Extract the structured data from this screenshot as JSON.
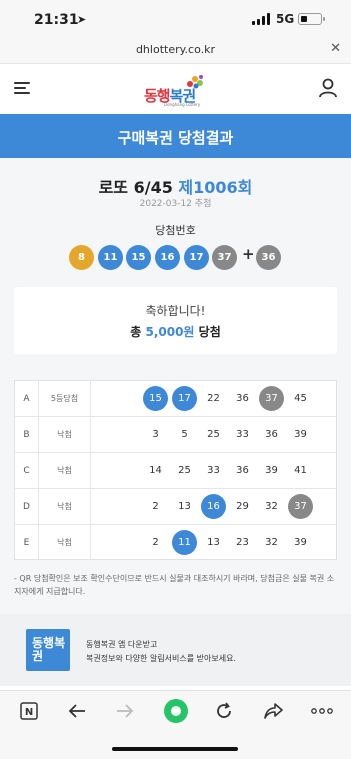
{
  "status_bar": {
    "time": "21:31",
    "network": "5G"
  },
  "url_bar": {
    "url": "dhlottery.co.kr",
    "close_icon": "close-icon"
  },
  "header": {
    "logo_text_red": "동행",
    "logo_text_blue": "복권",
    "logo_subtitle": "Donghang Lottery",
    "menu_icon": "hamburger-icon",
    "user_icon": "user-icon"
  },
  "banner": {
    "title": "구매복권 당첨결과"
  },
  "draw": {
    "game": "로또 6/45",
    "round": "제1006회",
    "date": "2022-03-12 추첨",
    "numbers_label": "당첨번호",
    "numbers": [
      "8",
      "11",
      "15",
      "16",
      "17",
      "37"
    ],
    "bonus": "36",
    "plus": "+"
  },
  "result": {
    "message": "축하합니다!",
    "amount_prefix": "총",
    "amount": "5,000원",
    "amount_suffix": "당첨"
  },
  "ticket": {
    "rows": [
      {
        "line": "A",
        "status": "5등당첨",
        "numbers": [
          "15",
          "17",
          "22",
          "36",
          "37",
          "45"
        ]
      },
      {
        "line": "B",
        "status": "낙첨",
        "numbers": [
          "3",
          "5",
          "25",
          "33",
          "36",
          "39"
        ]
      },
      {
        "line": "C",
        "status": "낙첨",
        "numbers": [
          "14",
          "25",
          "33",
          "36",
          "39",
          "41"
        ]
      },
      {
        "line": "D",
        "status": "낙첨",
        "numbers": [
          "2",
          "13",
          "16",
          "29",
          "32",
          "37"
        ]
      },
      {
        "line": "E",
        "status": "낙첨",
        "numbers": [
          "2",
          "11",
          "13",
          "23",
          "32",
          "39"
        ]
      }
    ]
  },
  "notice": "- QR 당첨확인은 보조 확인수단이므로 반드시 실물과 대조하시기 바라며, 당첨금은 실물 복권 소지자에게 지급합니다.",
  "promo": {
    "logo_text": "동행복권",
    "line1": "동행복권 앱 다운받고",
    "line2": "복권정보와 다양한 알림서비스를 받아보세요."
  },
  "colors": {
    "accent_blue": "#3d88d7",
    "ball_yellow": "#e4a72b",
    "ball_gray": "#888888",
    "logo_red": "#e4343e"
  },
  "toolbar": {
    "icons": [
      "naver-n-icon",
      "back-arrow-icon",
      "forward-arrow-icon",
      "home-circle-icon",
      "reload-icon",
      "share-icon",
      "more-icon"
    ]
  }
}
